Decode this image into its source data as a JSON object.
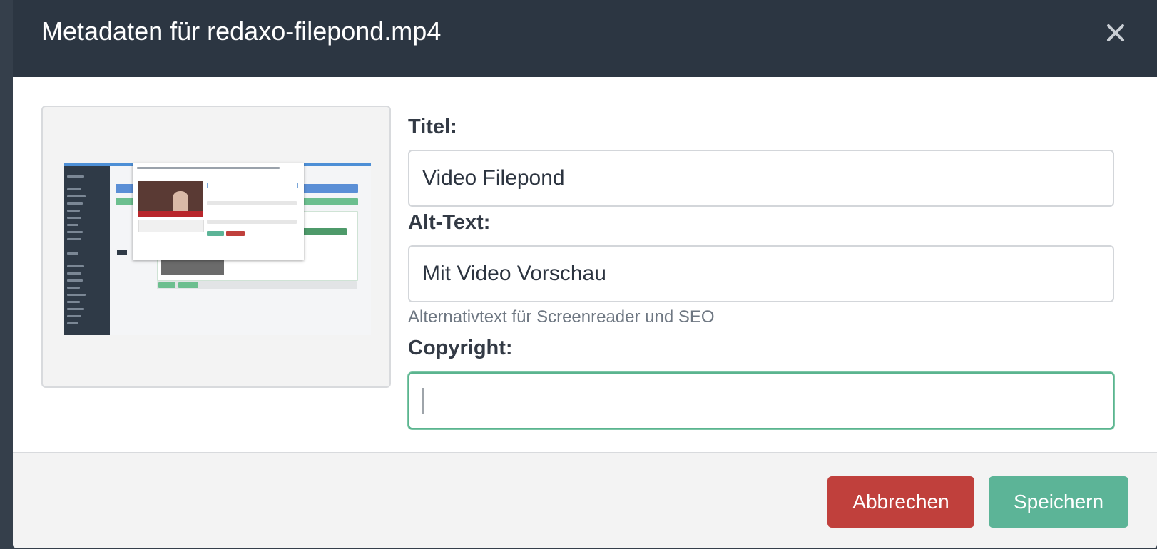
{
  "modal": {
    "title": "Metadaten für redaxo-filepond.mp4",
    "close_icon": "close-icon"
  },
  "preview": {
    "icon": "video-thumbnail-image"
  },
  "form": {
    "title": {
      "label": "Titel:",
      "value": "Video Filepond"
    },
    "alt_text": {
      "label": "Alt-Text:",
      "value": "Mit Video Vorschau",
      "help": "Alternativtext für Screenreader und SEO"
    },
    "copyright": {
      "label": "Copyright:",
      "value": ""
    }
  },
  "footer": {
    "cancel_label": "Abbrechen",
    "save_label": "Speichern"
  },
  "colors": {
    "header_bg": "#2c3642",
    "cancel": "#c0403c",
    "save": "#5cb497",
    "focus_border": "#5bb48f"
  }
}
